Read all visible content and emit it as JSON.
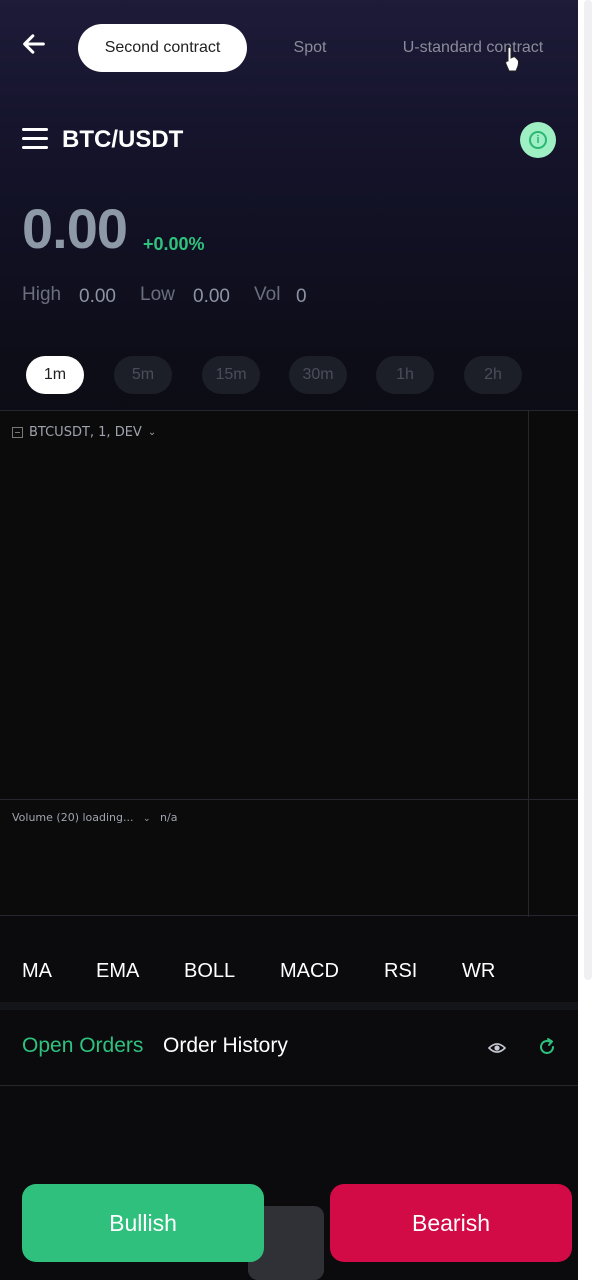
{
  "top_tabs": [
    {
      "label": "Second contract",
      "active": true
    },
    {
      "label": "Spot",
      "active": false
    },
    {
      "label": "U-standard contract",
      "active": false
    }
  ],
  "header": {
    "pair": "BTC/USDT",
    "price": "0.00",
    "change": "+0.00%",
    "stats": {
      "high_label": "High",
      "high_value": "0.00",
      "low_label": "Low",
      "low_value": "0.00",
      "vol_label": "Vol",
      "vol_value": "0"
    }
  },
  "intervals": [
    {
      "label": "1m",
      "active": true
    },
    {
      "label": "5m",
      "active": false
    },
    {
      "label": "15m",
      "active": false
    },
    {
      "label": "30m",
      "active": false
    },
    {
      "label": "1h",
      "active": false
    },
    {
      "label": "2h",
      "active": false
    }
  ],
  "chart": {
    "legend": "BTCUSDT, 1, DEV",
    "volume_legend": "Volume (20) loading...",
    "volume_value": "n/a"
  },
  "indicators": [
    "MA",
    "EMA",
    "BOLL",
    "MACD",
    "RSI",
    "WR"
  ],
  "orders": {
    "open_orders": "Open Orders",
    "order_history": "Order History"
  },
  "actions": {
    "bullish": "Bullish",
    "bearish": "Bearish"
  },
  "colors": {
    "accent_green": "#2ec27e",
    "bullish": "#2fc07d",
    "bearish": "#d20a45"
  },
  "icons": {
    "back": "arrow-left-icon",
    "menu": "hamburger-icon",
    "info": "info-icon",
    "visibility": "eye-icon",
    "refresh": "refresh-icon"
  }
}
